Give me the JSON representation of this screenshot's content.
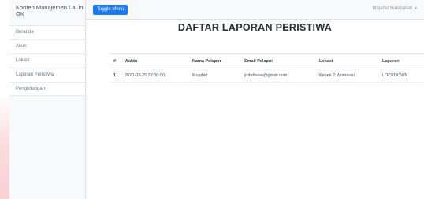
{
  "sidebar": {
    "heading": "Konten Manajemen LaLin GK",
    "items": [
      {
        "label": "Beranda"
      },
      {
        "label": "Akun"
      },
      {
        "label": "Lokasi"
      },
      {
        "label": "Laporan Peristiwa"
      },
      {
        "label": "Penghitungan"
      }
    ]
  },
  "topbar": {
    "toggle_label": "Toggle Menu",
    "user_name": "Mujahid Habibullah",
    "caret": "▼"
  },
  "main": {
    "title": "DAFTAR LAPORAN PERISTIWA",
    "table": {
      "headers": [
        "#",
        "Waktu",
        "Nama Pelapor",
        "Email Pelapor",
        "Lokasi",
        "Laporan"
      ],
      "rows": [
        [
          "1",
          "2020-03-25 22:00:00",
          "Mujahid",
          "jmhdoase@gmail.com",
          "Kepek 2 Wonosari",
          "LOCKDOWN"
        ]
      ]
    }
  }
}
